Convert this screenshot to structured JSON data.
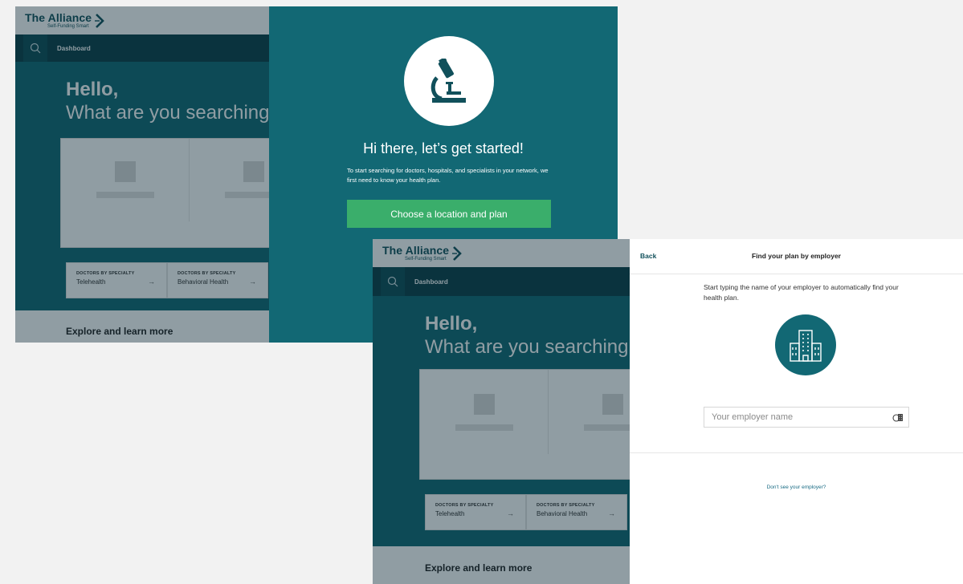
{
  "brand": {
    "name": "The Alliance",
    "tagline": "Self-Funding Smart"
  },
  "dashboard": {
    "nav_label": "Dashboard",
    "greeting": "Hello,",
    "question": "What are you searching for?",
    "specialties": [
      {
        "kicker": "DOCTORS BY SPECIALTY",
        "title": "Telehealth",
        "arrow": "→"
      },
      {
        "kicker": "DOCTORS BY SPECIALTY",
        "title": "Behavioral Health",
        "arrow": "→"
      }
    ],
    "explore_heading": "Explore and learn more"
  },
  "intro_modal": {
    "icon": "microscope-icon",
    "title": "Hi there, let’s get started!",
    "body": "To start searching for doctors, hospitals, and specialists in your network, we first need to know your health plan.",
    "cta": "Choose a location and plan"
  },
  "employer_modal": {
    "back_label": "Back",
    "title": "Find your plan by employer",
    "instruction": "Start typing the name of your employer to automatically find your health plan.",
    "icon": "building-icon",
    "input": {
      "placeholder": "Your employer name",
      "value": ""
    },
    "not_listed_link": "Don't see your employer?"
  },
  "colors": {
    "teal": "#126874",
    "dark_teal": "#0b3e48",
    "brand_text": "#11505b",
    "cta_green": "#3aae6b",
    "page_bg": "#f2f2f2"
  }
}
